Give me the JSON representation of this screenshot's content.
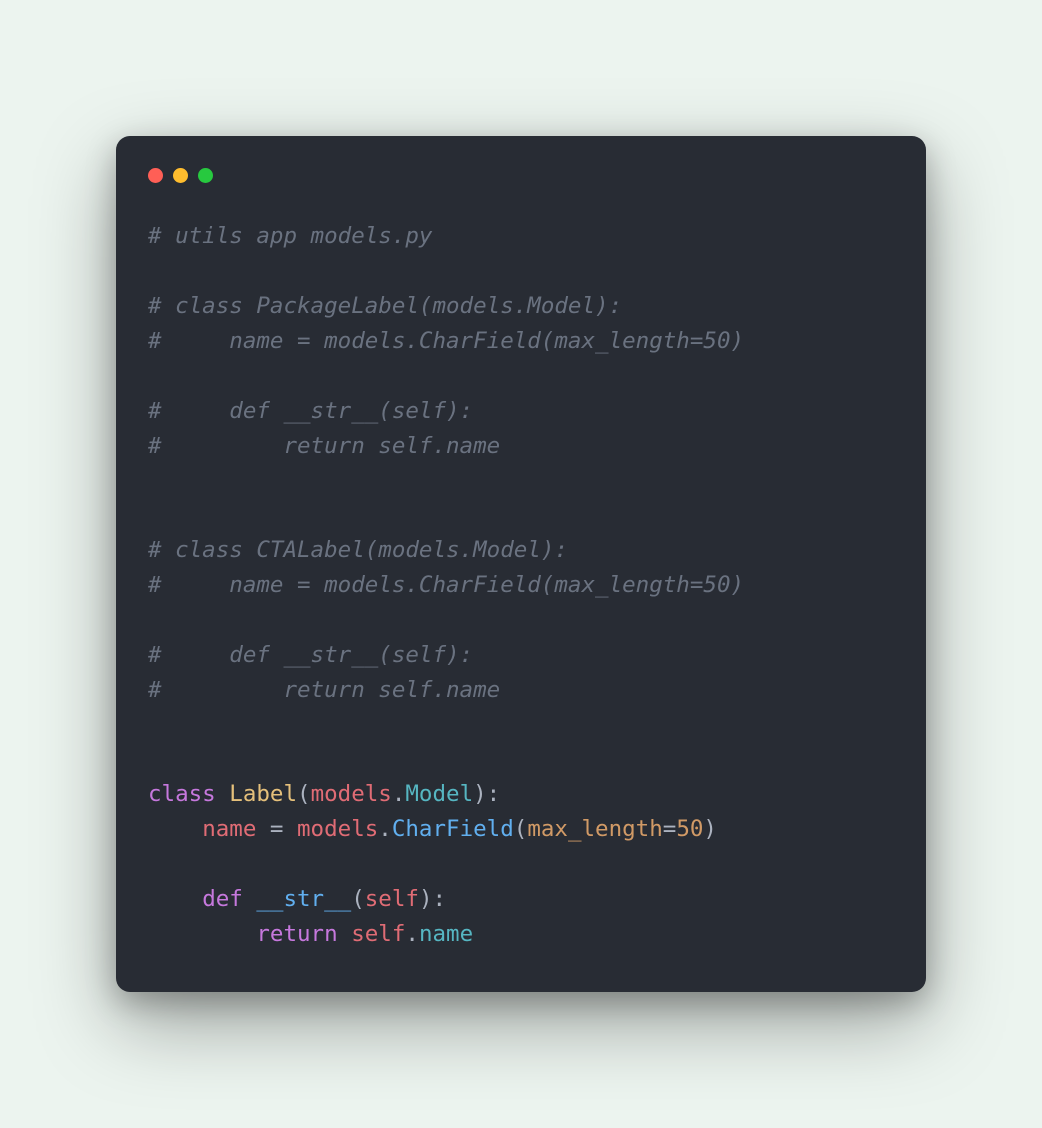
{
  "colors": {
    "bg_page": "#ecf4ef",
    "bg_window": "#282c34",
    "traffic_red": "#ff5f56",
    "traffic_yellow": "#ffbd2e",
    "traffic_green": "#27c93f",
    "comment": "#6a7280",
    "keyword": "#c678dd",
    "classname": "#e5c07b",
    "funcname": "#61afef",
    "var": "#e06c75",
    "attr": "#56b6c2",
    "param": "#d19a66",
    "num": "#d19a66",
    "self": "#e5c07b",
    "plain": "#abb2bf"
  },
  "code": {
    "c1": "# utils app models.py",
    "c2": "# class PackageLabel(models.Model):",
    "c3": "#     name = models.CharField(max_length=50)",
    "c4": "#     def __str__(self):",
    "c5": "#         return self.name",
    "c6": "# class CTALabel(models.Model):",
    "c7": "#     name = models.CharField(max_length=50)",
    "c8": "#     def __str__(self):",
    "c9": "#         return self.name",
    "kw_class": "class",
    "cls_Label": "Label",
    "mod_models": "models",
    "cls_Model": "Model",
    "ident_name": "name",
    "fn_CharField": "CharField",
    "param_max_length": "max_length",
    "num_50": "50",
    "kw_def": "def",
    "fn_str": "__str__",
    "ident_self": "self",
    "kw_return": "return",
    "attr_name": "name",
    "lparen": "(",
    "rparen": ")",
    "colon": ":",
    "eq": "=",
    "dot": "."
  }
}
